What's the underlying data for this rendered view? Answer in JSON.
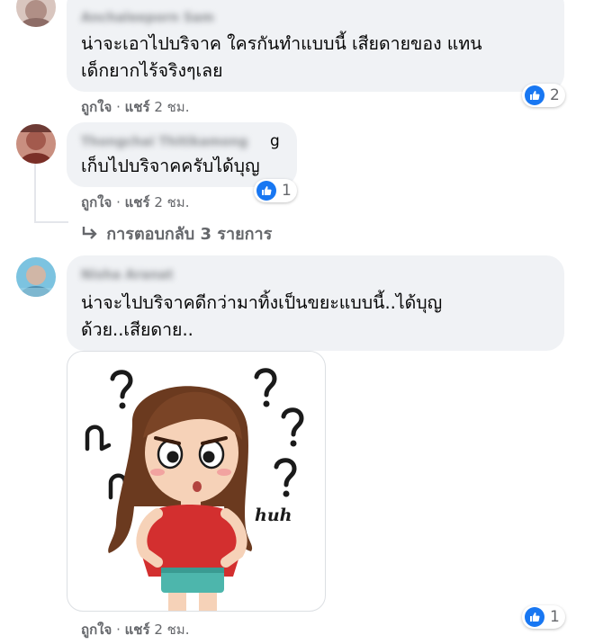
{
  "comments": [
    {
      "author": "Anchaleeporn Sam",
      "text_lines": [
        "น่าจะเอาไปบริจาค ใครกันทำแบบนี้ เสียดายของ แทน",
        "เด็กยากไร้จริงๆเลย"
      ],
      "like_label": "ถูกใจ",
      "share_label": "แชร์",
      "time": "2 ชม.",
      "separator": "·",
      "reaction_count": "2"
    },
    {
      "author": "Thongchai Thitikamong",
      "author_visible_tail": "g",
      "text_lines": [
        "เก็บไปบริจาคครับได้บุญ"
      ],
      "like_label": "ถูกใจ",
      "share_label": "แชร์",
      "time": "2 ชม.",
      "separator": "·",
      "reaction_count": "1",
      "replies_label": "การตอบกลับ 3 รายการ"
    },
    {
      "author": "Nisha Aranat",
      "text_lines": [
        "น่าจะไปบริจาคดีกว่ามาทิ้งเป็นขยะแบบนี้..ได้บุญ",
        "ด้วย..เสียดาย.."
      ],
      "sticker_text": "huh",
      "like_label": "ถูกใจ",
      "share_label": "แชร์",
      "time": "2 ชม.",
      "separator": "·",
      "reaction_count": "1"
    }
  ],
  "icons": {
    "reaction": "like-thumb-icon",
    "replies_arrow": "reply-arrow-icon"
  },
  "colors": {
    "bubble": "#f0f2f5",
    "like_blue": "#1877f2",
    "meta_text": "#65676b"
  }
}
